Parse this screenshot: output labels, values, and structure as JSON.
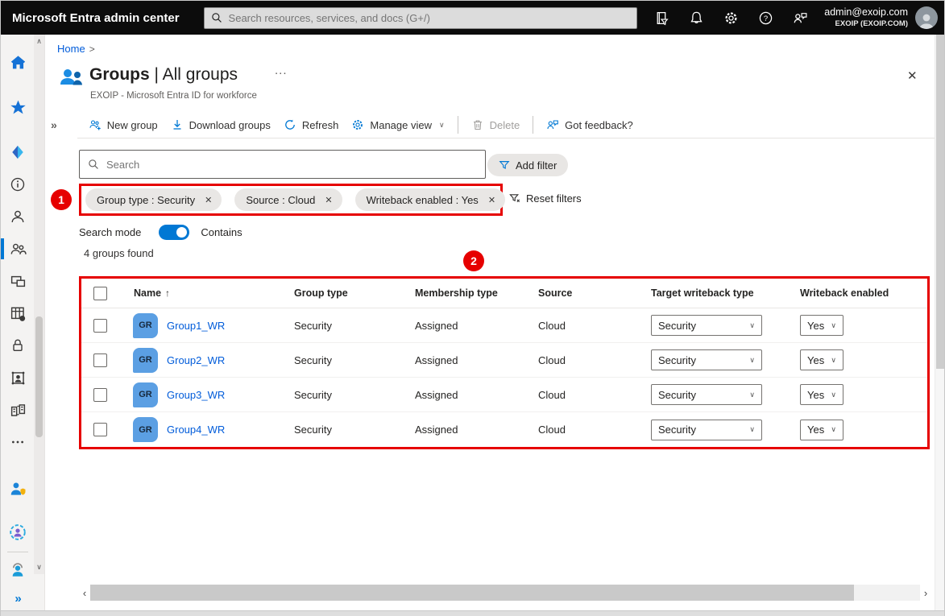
{
  "topbar": {
    "brand": "Microsoft Entra admin center",
    "search_placeholder": "Search resources, services, and docs (G+/)",
    "icons": [
      "directory-filter",
      "notifications",
      "settings",
      "help",
      "feedback"
    ],
    "account": {
      "email": "admin@exoip.com",
      "tenant": "EXOIP (EXOIP.COM)"
    }
  },
  "sidebar": {
    "icons": [
      "home",
      "favorites",
      "entra-id",
      "information",
      "users",
      "groups",
      "devices",
      "applications",
      "protection",
      "external-identities",
      "organization",
      "show-more",
      "roles-admins",
      "identity-governance",
      "learn-support"
    ],
    "selected": "groups",
    "expand_label": "»"
  },
  "breadcrumb": {
    "home": "Home",
    "separator": ">"
  },
  "page": {
    "title_bold": "Groups",
    "title_rest": " | All groups",
    "overflow": "...",
    "subtitle": "EXOIP - Microsoft Entra ID for workforce",
    "close": "✕"
  },
  "toolbar": {
    "collapse": "»",
    "items": [
      {
        "label": "New group"
      },
      {
        "label": "Download groups"
      },
      {
        "label": "Refresh"
      },
      {
        "label": "Manage view"
      },
      {
        "label": "Delete"
      },
      {
        "label": "Got feedback?"
      }
    ]
  },
  "filters": {
    "search_placeholder": "Search",
    "add_filter": "Add filter",
    "pills": [
      "Group type : Security",
      "Source : Cloud",
      "Writeback enabled : Yes"
    ],
    "remove_glyph": "✕",
    "reset": "Reset filters"
  },
  "search_mode": {
    "label": "Search mode",
    "state": "Contains",
    "enabled": true
  },
  "results_count": "4 groups found",
  "annotations": {
    "badge1": "1",
    "badge2": "2",
    "color": "#e60000"
  },
  "table": {
    "headers": [
      "Name",
      "Group type",
      "Membership type",
      "Source",
      "Target writeback type",
      "Writeback enabled"
    ],
    "sort_arrow": "↑",
    "rows": [
      {
        "avatar": "GR",
        "name": "Group1_WR",
        "group_type": "Security",
        "membership_type": "Assigned",
        "source": "Cloud",
        "target_writeback_type": "Security",
        "writeback_enabled": "Yes"
      },
      {
        "avatar": "GR",
        "name": "Group2_WR",
        "group_type": "Security",
        "membership_type": "Assigned",
        "source": "Cloud",
        "target_writeback_type": "Security",
        "writeback_enabled": "Yes"
      },
      {
        "avatar": "GR",
        "name": "Group3_WR",
        "group_type": "Security",
        "membership_type": "Assigned",
        "source": "Cloud",
        "target_writeback_type": "Security",
        "writeback_enabled": "Yes"
      },
      {
        "avatar": "GR",
        "name": "Group4_WR",
        "group_type": "Security",
        "membership_type": "Assigned",
        "source": "Cloud",
        "target_writeback_type": "Security",
        "writeback_enabled": "Yes"
      }
    ]
  },
  "colors": {
    "accent": "#0078d4",
    "link": "#015cda",
    "annotation": "#e60000",
    "topbar": "#0c0c0c",
    "avatar_bg": "#5b9fe3"
  }
}
